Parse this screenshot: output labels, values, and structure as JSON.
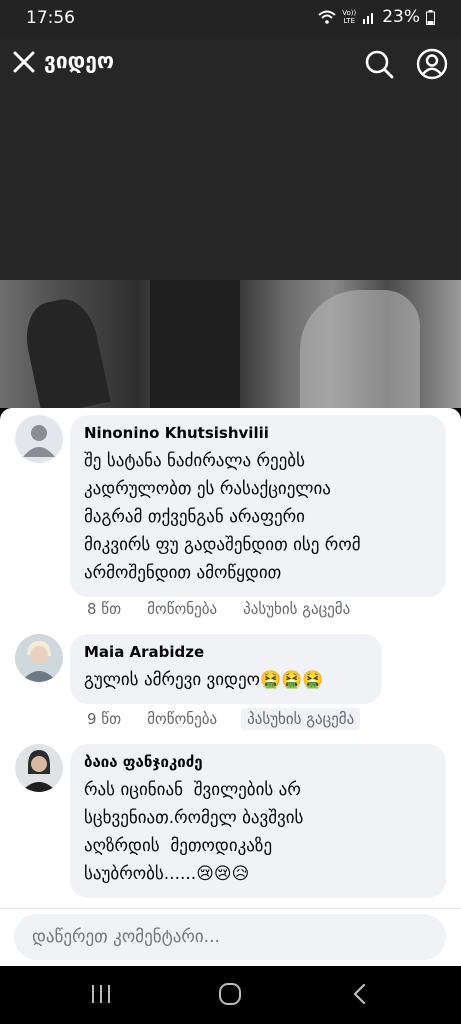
{
  "status": {
    "time": "17:56",
    "battery": "23%",
    "volte_top": "Vo))",
    "volte_bottom": "LTE"
  },
  "header": {
    "title": "ვიდეო"
  },
  "icons": {
    "close": "close-icon",
    "search": "search-icon",
    "profile": "profile-icon"
  },
  "comments": [
    {
      "author": "Ninonino Khutsishvilii",
      "text": "შე სატანა ნაძირალა რეებს\nკადრულობთ ეს რასაქციელია\nმაგრამ თქვენგან არაფერი\nმიკვირს ფუ გადაშენდით ისე რომ\nარმოშენდით ამოწყდით",
      "time": "8 წთ",
      "like": "მოწონება",
      "reply": "პასუხის გაცემა"
    },
    {
      "author": "Maia Arabidze",
      "text": "გულის ამრევი ვიდეო🤮🤮🤮",
      "time": "9 წთ",
      "like": "მოწონება",
      "reply": "პასუხის გაცემა"
    },
    {
      "author": "ბაია ფანჯიკიძე",
      "text": "რას იცინიან  შვილების არ\nსცხვენიათ.რომელ ბავშვის\nაღზრდის  მეთოდიკაზე\nსაუბრობს......😢😢😥",
      "time": "",
      "like": "",
      "reply": ""
    }
  ],
  "composer": {
    "placeholder": "დაწერეთ კომენტარი..."
  },
  "colors": {
    "bubble": "#f0f2f5",
    "meta": "#65676b",
    "header_bg": "#262626"
  }
}
